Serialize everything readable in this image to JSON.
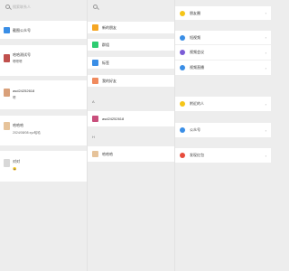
{
  "search": {
    "placeholder": "搜索联系人"
  },
  "chats": [
    {
      "title": "截图公众号"
    },
    {
      "title": "哈哈测试号",
      "subtitle": "嗯嗯嗯"
    },
    {
      "title": "asd24252618",
      "subtitle": "嗯"
    },
    {
      "title": "哈哈哈",
      "subtitle": "2024/08/08 xyz哈哈"
    },
    {
      "title": "对对",
      "subtitle": "😀"
    }
  ],
  "contacts": {
    "menu": [
      {
        "label": "新的朋友",
        "color": "#f5a623"
      },
      {
        "label": "群组",
        "color": "#2ecc71"
      },
      {
        "label": "标签",
        "color": "#3a8ee6"
      },
      {
        "label": "我的好友",
        "color": "#f08a5d"
      }
    ],
    "group_a_label": "A",
    "group_a_item": "asd24252618",
    "group_h_label": "H",
    "group_h_item": "哈哈哈"
  },
  "discover": [
    {
      "label": "朋友圈",
      "color": "#f5c518"
    },
    {
      "label": "短视频",
      "color": "#3a8ee6"
    },
    {
      "label": "视频会议",
      "color": "#7b5cd6"
    },
    {
      "label": "视频直播",
      "color": "#3a8ee6"
    },
    {
      "label": "附近的人",
      "color": "#f5c518"
    },
    {
      "label": "公众号",
      "color": "#3a8ee6"
    },
    {
      "label": "发现红包",
      "color": "#e74c3c"
    }
  ]
}
